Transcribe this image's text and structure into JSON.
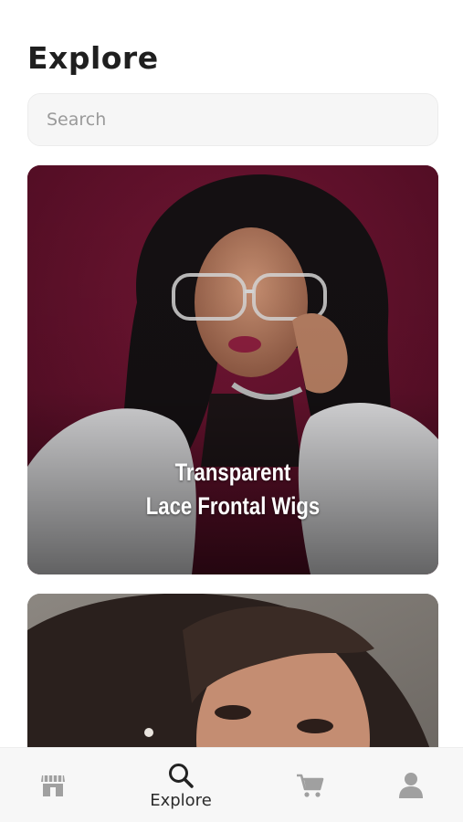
{
  "header": {
    "title": "Explore"
  },
  "search": {
    "placeholder": "Search"
  },
  "cards": [
    {
      "caption_line1": "Transparent",
      "caption_line2": "Lace Frontal Wigs",
      "image": "woman-with-glasses-photo"
    },
    {
      "image": "woman-long-hair-photo"
    }
  ],
  "tabbar": {
    "items": [
      {
        "icon": "storefront-icon",
        "label": "",
        "active": false
      },
      {
        "icon": "search-icon",
        "label": "Explore",
        "active": true
      },
      {
        "icon": "cart-icon",
        "label": "",
        "active": false
      },
      {
        "icon": "user-icon",
        "label": "",
        "active": false
      }
    ]
  },
  "colors": {
    "background": "#ffffff",
    "card1_backdrop": "#5e1029",
    "icon_inactive": "#a0a0a0",
    "icon_active": "#222222"
  }
}
